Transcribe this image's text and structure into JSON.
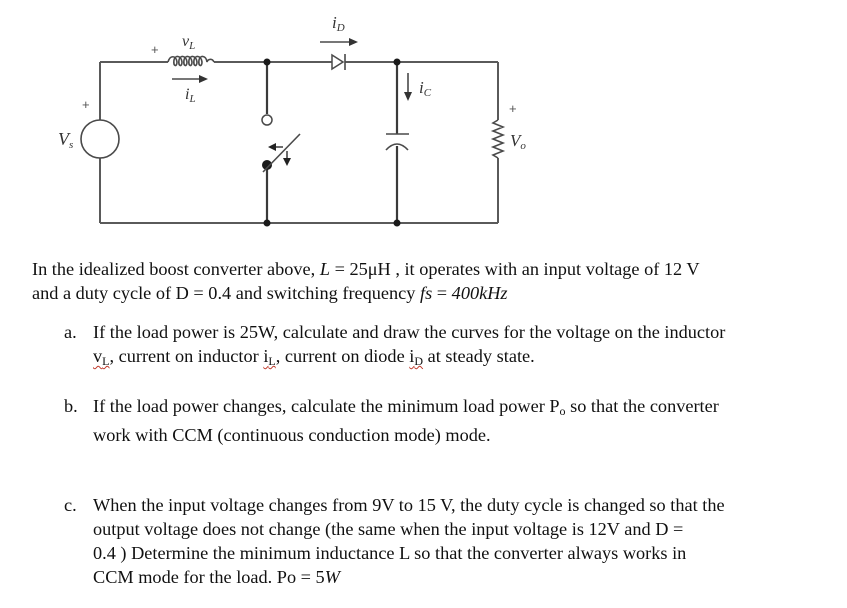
{
  "circuit": {
    "title": "Idealized boost converter",
    "labels": {
      "source": "V",
      "source_sub": "s",
      "inductor_voltage": "v",
      "inductor_voltage_sub": "L",
      "inductor_current": "i",
      "inductor_current_sub": "L",
      "diode_current": "i",
      "diode_current_sub": "D",
      "capacitor_current": "i",
      "capacitor_current_sub": "C",
      "output_voltage": "V",
      "output_voltage_sub": "o",
      "plus": "+"
    },
    "components": [
      "voltage-source",
      "inductor",
      "switch",
      "diode",
      "capacitor",
      "load-resistor"
    ]
  },
  "problem": {
    "intro_line1_a": "In the idealized boost converter above, ",
    "intro_L_sym": "L",
    "intro_L_eq": " = 25μH",
    "intro_line1_b": " , it operates with an input voltage of 12 V",
    "intro_line2_a": "and a duty cycle of D = 0.4 and switching frequency ",
    "intro_fs": "fs",
    "intro_fs_eq": " = ",
    "intro_fs_val": "400kHz",
    "items": [
      {
        "marker": "a.",
        "line1": "If the load power is 25W, calculate and draw the curves for the voltage on the inductor",
        "line2_v": "v",
        "line2_v_sub": "L",
        "line2_a": ", current on inductor ",
        "line2_i": "i",
        "line2_i_sub": "L",
        "line2_b": ", current on diode ",
        "line2_id": "i",
        "line2_id_sub": "D",
        "line2_c": " at steady state."
      },
      {
        "marker": "b.",
        "line1_a": "If the load power changes, calculate the minimum load power P",
        "line1_sub": "o",
        "line1_b": " so that the converter",
        "line2": "work with CCM (continuous conduction mode) mode."
      },
      {
        "marker": "c.",
        "line1": "When the input voltage changes from 9V to 15 V, the duty cycle is changed so that the",
        "line2": "output voltage does not change (the same when the input voltage is 12V and D =",
        "line3": "0.4 ) Determine the minimum inductance L so that the converter always works in",
        "line4_a": "CCM mode for the load. Po = 5",
        "line4_b": "W"
      }
    ]
  }
}
